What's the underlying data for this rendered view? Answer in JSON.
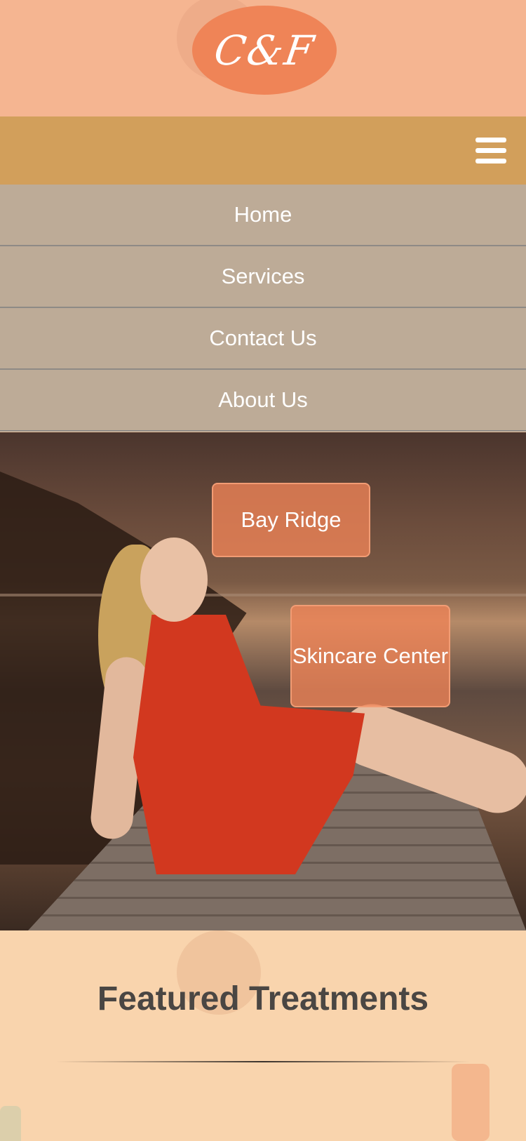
{
  "header": {
    "logo_text": "C&F"
  },
  "menu": {
    "items": [
      {
        "label": "Home"
      },
      {
        "label": "Services"
      },
      {
        "label": "Contact Us"
      },
      {
        "label": "About Us"
      }
    ]
  },
  "hero": {
    "buttons": [
      {
        "label": "Bay Ridge"
      },
      {
        "label": "Skincare Center"
      }
    ]
  },
  "featured": {
    "title": "Featured Treatments"
  },
  "colors": {
    "header_bg": "#f5b591",
    "logo_bg": "#ef8457",
    "navbar_bg": "#d29f5b",
    "menu_bg": "#bdab97",
    "section_bg": "#f9d4ad"
  }
}
